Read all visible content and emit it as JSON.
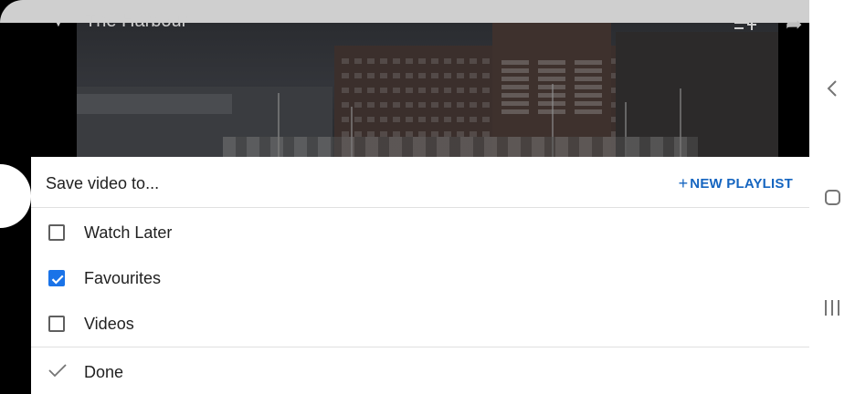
{
  "video": {
    "title": "The Harbour"
  },
  "sheet": {
    "title": "Save video to...",
    "new_playlist_label": "NEW PLAYLIST",
    "new_playlist_plus": "+",
    "playlists": [
      {
        "label": "Watch Later",
        "checked": false
      },
      {
        "label": "Favourites",
        "checked": true
      },
      {
        "label": "Videos",
        "checked": false
      }
    ],
    "done_label": "Done"
  },
  "colors": {
    "accent": "#1a73e8",
    "link": "#1565c0"
  },
  "icons": {
    "back": "chevron-left-icon",
    "home": "home-square-icon",
    "recents": "recents-icon",
    "done": "check-icon"
  }
}
